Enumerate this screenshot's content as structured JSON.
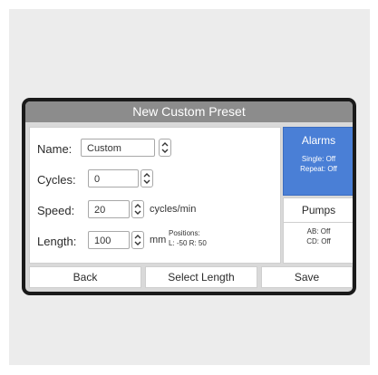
{
  "window": {
    "title": "New Custom Preset"
  },
  "form": {
    "name": {
      "label": "Name:",
      "value": "Custom"
    },
    "cycles": {
      "label": "Cycles:",
      "value": "0"
    },
    "speed": {
      "label": "Speed:",
      "value": "20",
      "unit": "cycles/min"
    },
    "length": {
      "label": "Length:",
      "value": "100",
      "unit": "mm",
      "positions_label": "Positions:",
      "positions_values": "L: -50  R: 50"
    }
  },
  "alarms": {
    "title": "Alarms",
    "single": "Single: Off",
    "repeat": "Repeat: Off",
    "color": "#4a7fd6"
  },
  "pumps": {
    "title": "Pumps",
    "ab": "AB: Off",
    "cd": "CD: Off"
  },
  "buttons": {
    "back": "Back",
    "select_length": "Select Length",
    "save": "Save"
  }
}
